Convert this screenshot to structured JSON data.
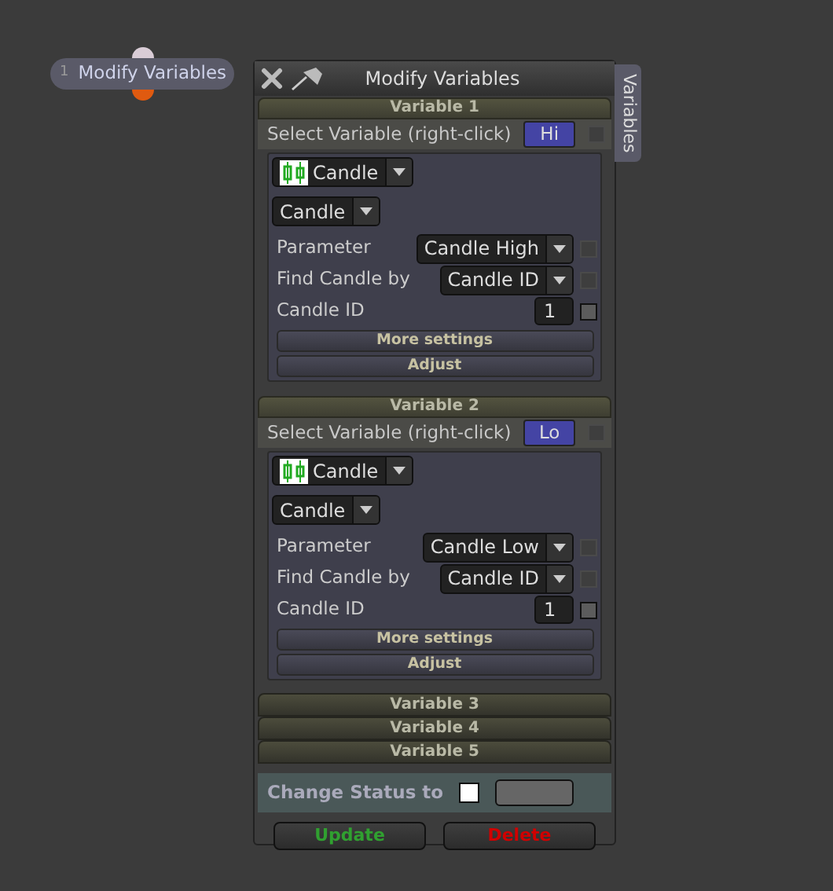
{
  "node": {
    "number": "1",
    "label": "Modify Variables"
  },
  "window": {
    "title": "Modify Variables",
    "side_tab": "Variables"
  },
  "variables": [
    {
      "header": "Variable 1",
      "expanded": true,
      "select_label": "Select Variable (right-click)",
      "variable_value": "Hi",
      "select_checked": false,
      "select_disabled": true,
      "type": "Candle",
      "subtype": "Candle",
      "fields": [
        {
          "kind": "dropdown",
          "label": "Parameter",
          "value": "Candle High",
          "checked": false,
          "disabled": true
        },
        {
          "kind": "dropdown",
          "label": "Find Candle by",
          "value": "Candle ID",
          "checked": false,
          "disabled": true
        },
        {
          "kind": "number",
          "label": "Candle ID",
          "value": "1",
          "checked": false
        }
      ],
      "buttons": [
        "More settings",
        "Adjust"
      ]
    },
    {
      "header": "Variable 2",
      "expanded": true,
      "select_label": "Select Variable (right-click)",
      "variable_value": "Lo",
      "select_checked": false,
      "select_disabled": true,
      "type": "Candle",
      "subtype": "Candle",
      "fields": [
        {
          "kind": "dropdown",
          "label": "Parameter",
          "value": "Candle Low",
          "checked": false,
          "disabled": true
        },
        {
          "kind": "dropdown",
          "label": "Find Candle by",
          "value": "Candle ID",
          "checked": false,
          "disabled": true
        },
        {
          "kind": "number",
          "label": "Candle ID",
          "value": "1",
          "checked": false
        }
      ],
      "buttons": [
        "More settings",
        "Adjust"
      ]
    },
    {
      "header": "Variable 3",
      "expanded": false
    },
    {
      "header": "Variable 4",
      "expanded": false
    },
    {
      "header": "Variable 5",
      "expanded": false
    }
  ],
  "status": {
    "label": "Change Status to",
    "checked": false
  },
  "actions": [
    {
      "kind": "update",
      "label": "Update"
    },
    {
      "kind": "delete",
      "label": "Delete"
    }
  ]
}
